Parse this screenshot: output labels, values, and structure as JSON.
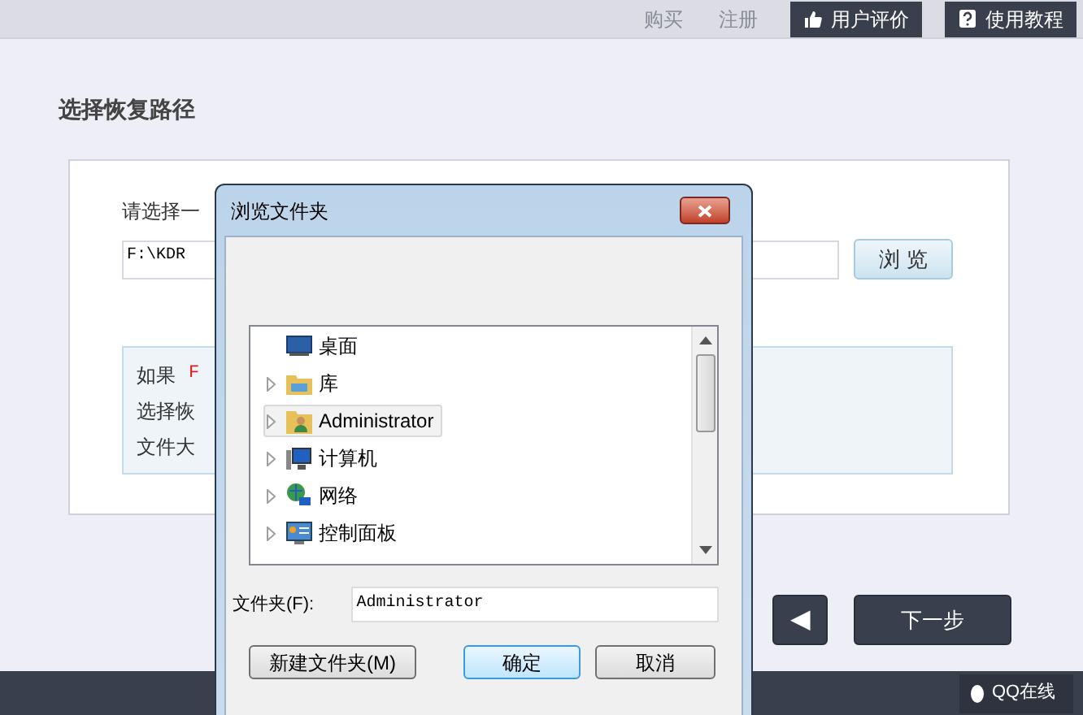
{
  "top_bar": {
    "links": [
      "购买",
      "注册"
    ],
    "buttons": [
      {
        "kind": "thumb",
        "label": "用户评价"
      },
      {
        "kind": "help",
        "label": "使用教程"
      }
    ]
  },
  "page_title": "选择恢复路径",
  "panel": {
    "prompt": "请选择一",
    "path_value": "F:\\KDR",
    "browse_button": "浏 览",
    "info": {
      "line_1": "如果",
      "line_1_mark": "F",
      "line_2": "选择恢",
      "line_3": "文件大"
    }
  },
  "nav": {
    "back_icon": "◀",
    "next_button": "下一步"
  },
  "footer": {
    "qq_button": "QQ在线"
  },
  "dialog": {
    "title": "浏览文件夹",
    "tree": [
      {
        "kind": "desktop",
        "label": "桌面",
        "expandable": false,
        "selected": false
      },
      {
        "kind": "library",
        "label": "库",
        "expandable": true,
        "selected": false
      },
      {
        "kind": "user",
        "label": "Administrator",
        "expandable": true,
        "selected": true
      },
      {
        "kind": "computer",
        "label": "计算机",
        "expandable": true,
        "selected": false
      },
      {
        "kind": "network",
        "label": "网络",
        "expandable": true,
        "selected": false
      },
      {
        "kind": "control",
        "label": "控制面板",
        "expandable": true,
        "selected": false
      }
    ],
    "folder_label": "文件夹(F):",
    "folder_value": "Administrator",
    "buttons": [
      {
        "label": "新建文件夹(M)",
        "default": false
      },
      {
        "label": "确定",
        "default": true
      },
      {
        "label": "取消",
        "default": false
      }
    ]
  }
}
